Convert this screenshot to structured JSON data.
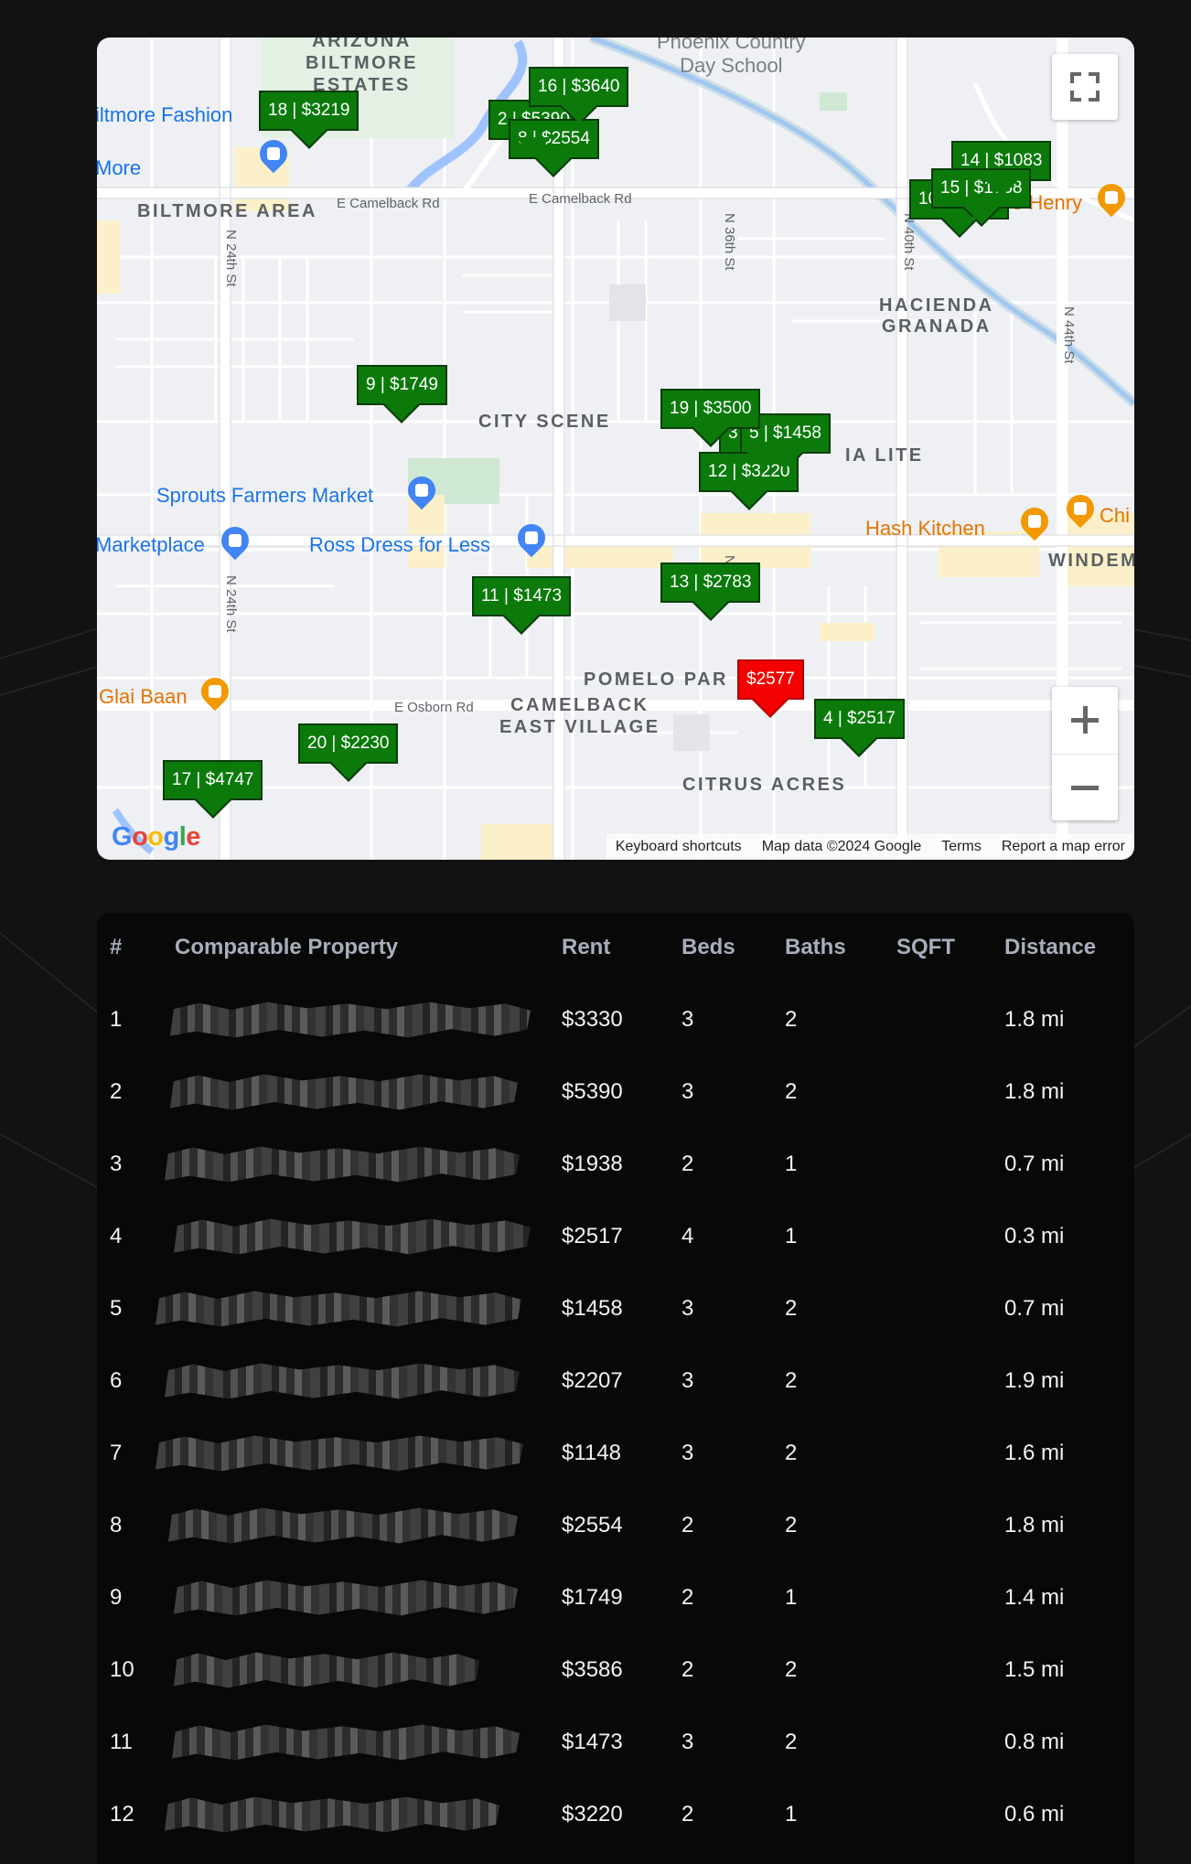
{
  "map": {
    "area_labels": {
      "arizona_biltmore": "ARIZONA\nBILTMORE\nESTATES",
      "biltmore_area": "BILTMORE AREA",
      "hacienda_granada": "HACIENDA\nGRANADA",
      "city_scene": "CITY SCENE",
      "via_lite": "IA LITE",
      "pomelo_park": "POMELO PAR",
      "camelback_east_village": "CAMELBACK\nEAST VILLAGE",
      "citrus_acres": "CITRUS ACRES",
      "winden": "WINDEM"
    },
    "street_labels": {
      "e_camelback_rd_1": "E Camelback Rd",
      "e_camelback_rd_2": "E Camelback Rd",
      "e_osborn_rd": "E Osborn Rd",
      "n_24th_st_1": "N 24th St",
      "n_24th_st_2": "N 24th St",
      "n_36th_st": "N 36th St",
      "n_40th_st": "N 40th St",
      "n_44th_st": "N 44th St",
      "partial_36th": "N"
    },
    "poi_labels": {
      "phoenix_country_day": "Phoenix Country\nDay School",
      "biltmore_fashion": "iltmore Fashion",
      "more": "More",
      "sprouts": "Sprouts Farmers Market",
      "marketplace": "Marketplace",
      "ross": "Ross Dress for Less",
      "hash_kitchen": "Hash Kitchen",
      "chi": "Chi",
      "glai_baan": "Glai Baan",
      "henry": "e Henry"
    },
    "markers": [
      {
        "label": "18 | $3219"
      },
      {
        "label": "2 | $5390"
      },
      {
        "label": "16 | $3640"
      },
      {
        "label": "8 | $2554"
      },
      {
        "label": "14 | $1083"
      },
      {
        "label": "10 | $3586"
      },
      {
        "label": "15 | $1768"
      },
      {
        "label": "9 | $1749"
      },
      {
        "label": "3 | $1938"
      },
      {
        "label": "5 | $1458"
      },
      {
        "label": "19 | $3500"
      },
      {
        "label": "12 | $3220"
      },
      {
        "label": "11 | $1473"
      },
      {
        "label": "13 | $2783"
      },
      {
        "label": "$2577"
      },
      {
        "label": "4 | $2517"
      },
      {
        "label": "20 | $2230"
      },
      {
        "label": "17 | $4747"
      }
    ],
    "google_logo": "Google",
    "attribution": {
      "keyboard": "Keyboard shortcuts",
      "map_data": "Map data ©2024 Google",
      "terms": "Terms",
      "report": "Report a map error"
    }
  },
  "table": {
    "headers": {
      "num": "#",
      "property": "Comparable Property",
      "rent": "Rent",
      "beds": "Beds",
      "baths": "Baths",
      "sqft": "SQFT",
      "distance": "Distance"
    },
    "rows": [
      {
        "num": "1",
        "rent": "$3330",
        "beds": "3",
        "baths": "2",
        "sqft": "",
        "distance": "1.8 mi"
      },
      {
        "num": "2",
        "rent": "$5390",
        "beds": "3",
        "baths": "2",
        "sqft": "",
        "distance": "1.8 mi"
      },
      {
        "num": "3",
        "rent": "$1938",
        "beds": "2",
        "baths": "1",
        "sqft": "",
        "distance": "0.7 mi"
      },
      {
        "num": "4",
        "rent": "$2517",
        "beds": "4",
        "baths": "1",
        "sqft": "",
        "distance": "0.3 mi"
      },
      {
        "num": "5",
        "rent": "$1458",
        "beds": "3",
        "baths": "2",
        "sqft": "",
        "distance": "0.7 mi"
      },
      {
        "num": "6",
        "rent": "$2207",
        "beds": "3",
        "baths": "2",
        "sqft": "",
        "distance": "1.9 mi"
      },
      {
        "num": "7",
        "rent": "$1148",
        "beds": "3",
        "baths": "2",
        "sqft": "",
        "distance": "1.6 mi"
      },
      {
        "num": "8",
        "rent": "$2554",
        "beds": "2",
        "baths": "2",
        "sqft": "",
        "distance": "1.8 mi"
      },
      {
        "num": "9",
        "rent": "$1749",
        "beds": "2",
        "baths": "1",
        "sqft": "",
        "distance": "1.4 mi"
      },
      {
        "num": "10",
        "rent": "$3586",
        "beds": "2",
        "baths": "2",
        "sqft": "",
        "distance": "1.5 mi"
      },
      {
        "num": "11",
        "rent": "$1473",
        "beds": "3",
        "baths": "2",
        "sqft": "",
        "distance": "0.8 mi"
      },
      {
        "num": "12",
        "rent": "$3220",
        "beds": "2",
        "baths": "1",
        "sqft": "",
        "distance": "0.6 mi"
      }
    ]
  },
  "colors": {
    "page_bg": "#121213",
    "table_bg": "#080808",
    "marker_green": "#0b7a0b",
    "marker_subject": "#f40000",
    "header_text": "#a7aebb"
  }
}
